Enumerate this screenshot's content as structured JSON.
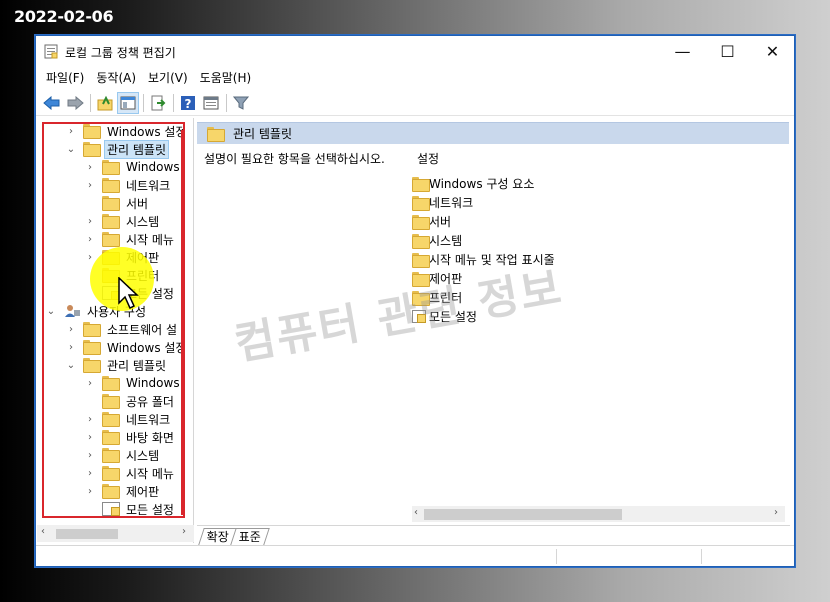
{
  "date_stamp": "2022-02-06",
  "window": {
    "title": "로컬 그룹 정책 편집기",
    "controls": {
      "minimize": "—",
      "maximize": "☐",
      "close": "✕"
    }
  },
  "menu": [
    "파일(F)",
    "동작(A)",
    "보기(V)",
    "도움말(H)"
  ],
  "toolbar": [
    "back-icon",
    "forward-icon",
    "up-folder-icon",
    "show-tree-icon",
    "export-list-icon",
    "help-icon",
    "properties-icon",
    "filter-icon"
  ],
  "tree": {
    "items": [
      {
        "label": "Windows 설정",
        "expander": "›"
      },
      {
        "label": "관리 템플릿",
        "expander": "⌄",
        "selected": true
      },
      {
        "label": "Windows",
        "expander": "›"
      },
      {
        "label": "네트워크",
        "expander": "›"
      },
      {
        "label": "서버",
        "expander": ""
      },
      {
        "label": "시스템",
        "expander": "›"
      },
      {
        "label": "시작 메뉴",
        "expander": "›"
      },
      {
        "label": "제어판",
        "expander": "›"
      },
      {
        "label": "프린터",
        "expander": ""
      },
      {
        "label": "모든 설정",
        "expander": ""
      },
      {
        "label": "사용자 구성",
        "expander": "⌄"
      },
      {
        "label": "소프트웨어 설",
        "expander": "›"
      },
      {
        "label": "Windows 설정",
        "expander": "›"
      },
      {
        "label": "관리 템플릿",
        "expander": "⌄"
      },
      {
        "label": "Windows",
        "expander": "›"
      },
      {
        "label": "공유 폴더",
        "expander": ""
      },
      {
        "label": "네트워크",
        "expander": "›"
      },
      {
        "label": "바탕 화면",
        "expander": "›"
      },
      {
        "label": "시스템",
        "expander": "›"
      },
      {
        "label": "시작 메뉴",
        "expander": "›"
      },
      {
        "label": "제어판",
        "expander": "›"
      },
      {
        "label": "모든 설정",
        "expander": ""
      }
    ]
  },
  "right_pane": {
    "header": "관리 템플릿",
    "description": "설명이 필요한 항목을 선택하십시오.",
    "column_header": "설정",
    "items": [
      "Windows 구성 요소",
      "네트워크",
      "서버",
      "시스템",
      "시작 메뉴 및 작업 표시줄",
      "제어판",
      "프린터",
      "모든 설정"
    ]
  },
  "tabs": [
    "확장",
    "표준"
  ],
  "watermark": "컴퓨터 관련 정보",
  "colors": {
    "accent": "#1f5fb4",
    "annotation_red": "#d9262c",
    "highlight_yellow": "#ffff00",
    "header_bg": "#c9d8ec"
  }
}
